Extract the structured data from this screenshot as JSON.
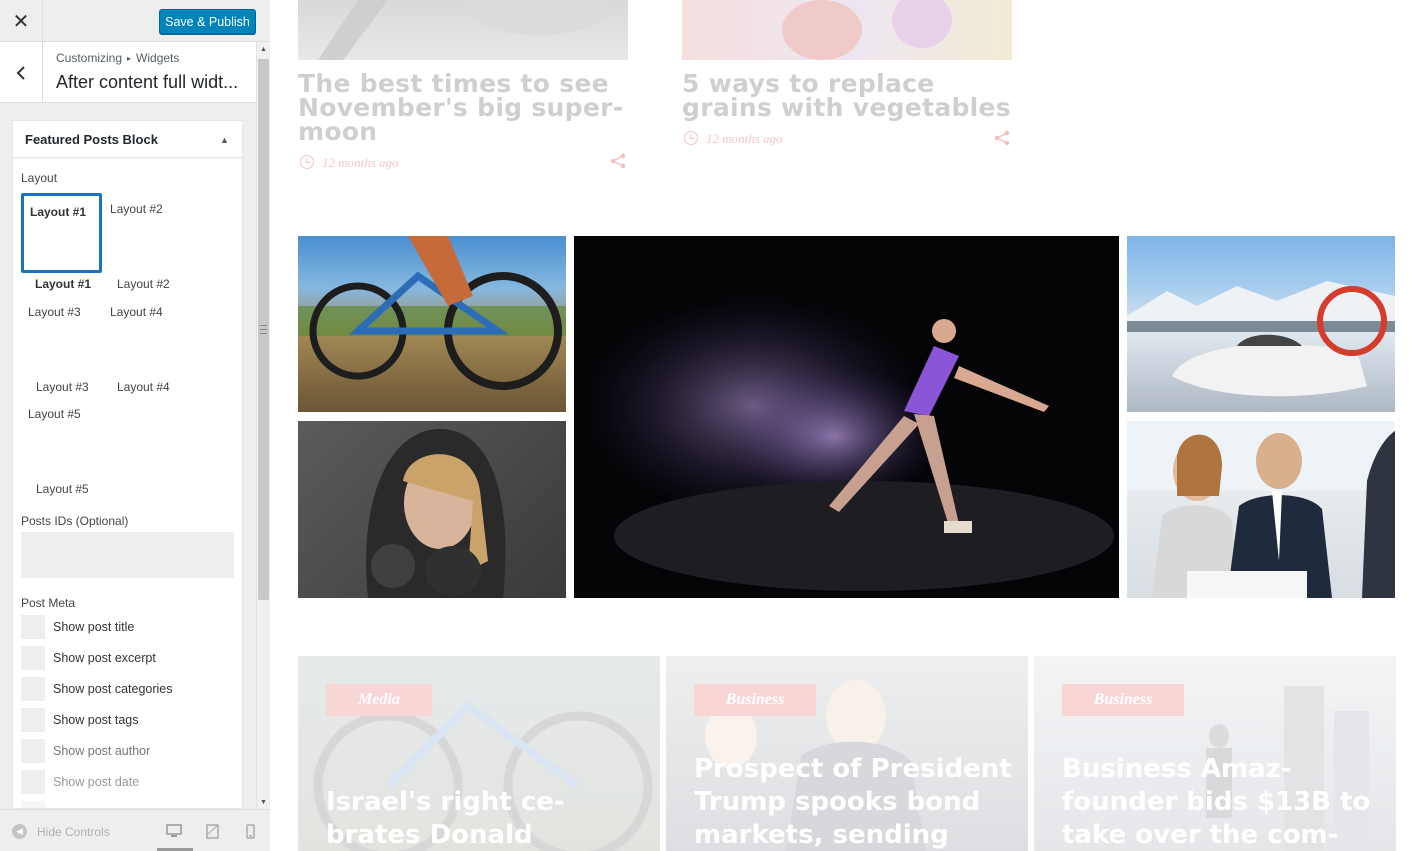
{
  "header": {
    "close_icon": "close-icon",
    "save_label": "Save & Publish"
  },
  "section": {
    "crumb_root": "Customizing",
    "crumb_sep": "▸",
    "crumb_leaf": "Widgets",
    "title": "After content full widt..."
  },
  "widget": {
    "title": "Featured Posts Block",
    "layout_label": "Layout",
    "selected_layout": "Layout #1",
    "layout_options": [
      "Layout #1",
      "Layout #2",
      "Layout #3",
      "Layout #4",
      "Layout #5"
    ],
    "post_ids_label": "Posts IDs (Optional)",
    "post_ids_value": "",
    "post_meta_label": "Post Meta",
    "post_meta_options": [
      "Show post title",
      "Show post excerpt",
      "Show post categories",
      "Show post tags",
      "Show post author",
      "Show post date"
    ]
  },
  "footer": {
    "hide_label": "Hide Controls"
  },
  "preview": {
    "top_posts": [
      {
        "title": "The best times to see November's big super-moon",
        "time": "12 months ago"
      },
      {
        "title": "5 ways to replace grains with vegetables",
        "time": "12 months ago"
      }
    ],
    "cards": [
      {
        "category": "Media",
        "title": "Israel's right ce- brates Donald"
      },
      {
        "category": "Business",
        "title": "Prospect of President Trump spooks bond markets, sending"
      },
      {
        "category": "Business",
        "title": "Business Amaz- founder bids $13B to take over the com-"
      }
    ]
  },
  "colors": {
    "accent": "#0085ba",
    "selection": "#1e73be",
    "badge": "#f9d6d6",
    "meta": "#f4c6c6"
  }
}
